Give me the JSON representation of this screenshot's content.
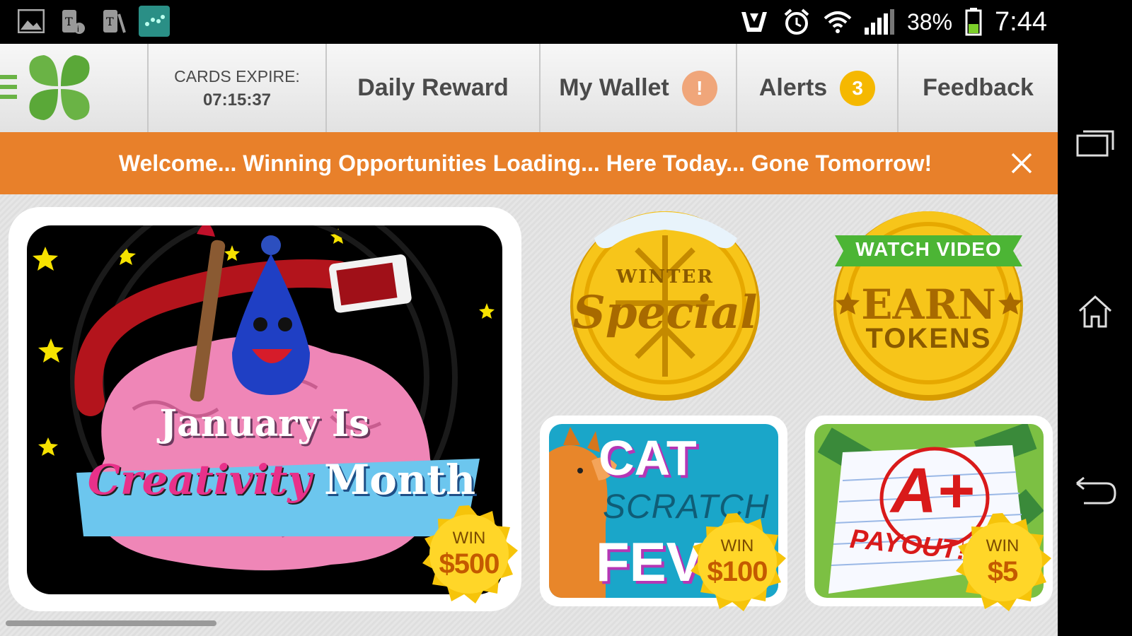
{
  "statusbar": {
    "battery_pct": "38%",
    "time": "7:44"
  },
  "header": {
    "cards_expire_label": "CARDS EXPIRE:",
    "cards_expire_time": "07:15:37",
    "daily_reward": "Daily Reward",
    "my_wallet": "My Wallet",
    "wallet_badge": "!",
    "alerts": "Alerts",
    "alerts_badge": "3",
    "feedback": "Feedback"
  },
  "banner": {
    "text": "Welcome... Winning Opportunities Loading... Here Today... Gone Tomorrow!"
  },
  "cards": {
    "main": {
      "line1": "January Is",
      "line2a": "Creativity",
      "line2b": "Month",
      "win_label": "WIN",
      "win_amount": "$500"
    },
    "winter": {
      "top": "WINTER",
      "main": "Special"
    },
    "video": {
      "ribbon": "WATCH VIDEO",
      "line1": "EARN",
      "line2": "TOKENS"
    },
    "cat": {
      "line1": "CAT",
      "line2": "SCRATCH",
      "line3": "FEVER",
      "win_label": "WIN",
      "win_amount": "$100"
    },
    "payout": {
      "grade": "A+",
      "word": "PAYOUT!",
      "win_label": "WIN",
      "win_amount": "$5"
    }
  },
  "colors": {
    "banner": "#e8802a",
    "wallet_badge": "#f0a67a",
    "alerts_badge": "#f5b800",
    "clover": "#6ab345"
  }
}
